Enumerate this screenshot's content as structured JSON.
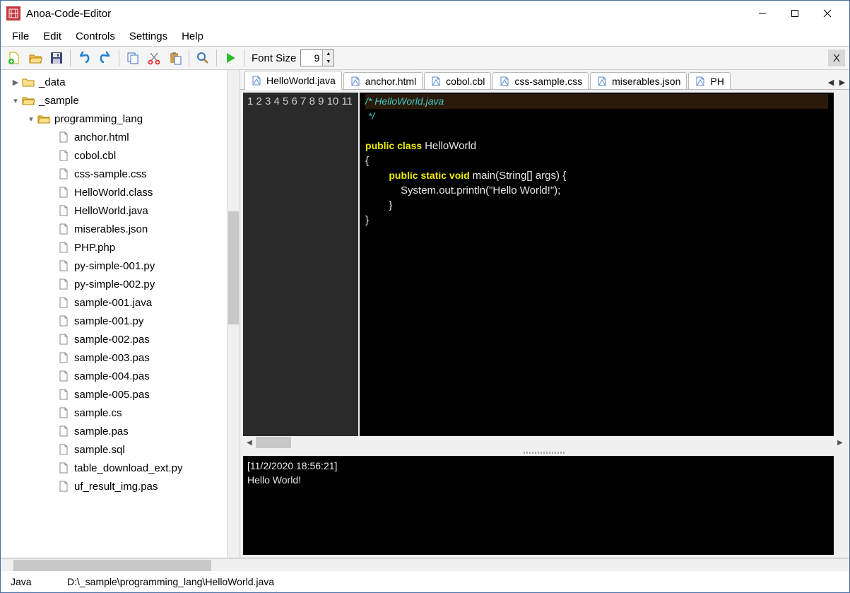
{
  "app": {
    "title": "Anoa-Code-Editor"
  },
  "menu": {
    "items": [
      "File",
      "Edit",
      "Controls",
      "Settings",
      "Help"
    ]
  },
  "toolbar": {
    "font_label": "Font Size",
    "font_value": "9",
    "close_x": "X"
  },
  "tree": {
    "root1": "_data",
    "root2": "_sample",
    "sub1": "programming_lang",
    "files": [
      "anchor.html",
      "cobol.cbl",
      "css-sample.css",
      "HelloWorld.class",
      "HelloWorld.java",
      "miserables.json",
      "PHP.php",
      "py-simple-001.py",
      "py-simple-002.py",
      "sample-001.java",
      "sample-001.py",
      "sample-002.pas",
      "sample-003.pas",
      "sample-004.pas",
      "sample-005.pas",
      "sample.cs",
      "sample.pas",
      "sample.sql",
      "table_download_ext.py",
      "uf_result_img.pas"
    ]
  },
  "tabs": {
    "items": [
      "HelloWorld.java",
      "anchor.html",
      "cobol.cbl",
      "css-sample.css",
      "miserables.json",
      "PH"
    ]
  },
  "code": {
    "line_count": 11,
    "l1": "/* HelloWorld.java",
    "l2": " */",
    "l3": "",
    "l4_kw": "public class ",
    "l4_rest": "HelloWorld",
    "l5": "{",
    "l6_kw": "public static void ",
    "l6_rest": "main(String[] args) {",
    "l7": "            System.out.println(\"Hello World!\");",
    "l8": "        }",
    "l9": "}"
  },
  "console": {
    "line1": "[11/2/2020 18:56:21]",
    "line2": "Hello World!"
  },
  "status": {
    "lang": "Java",
    "path": "D:\\_sample\\programming_lang\\HelloWorld.java"
  }
}
